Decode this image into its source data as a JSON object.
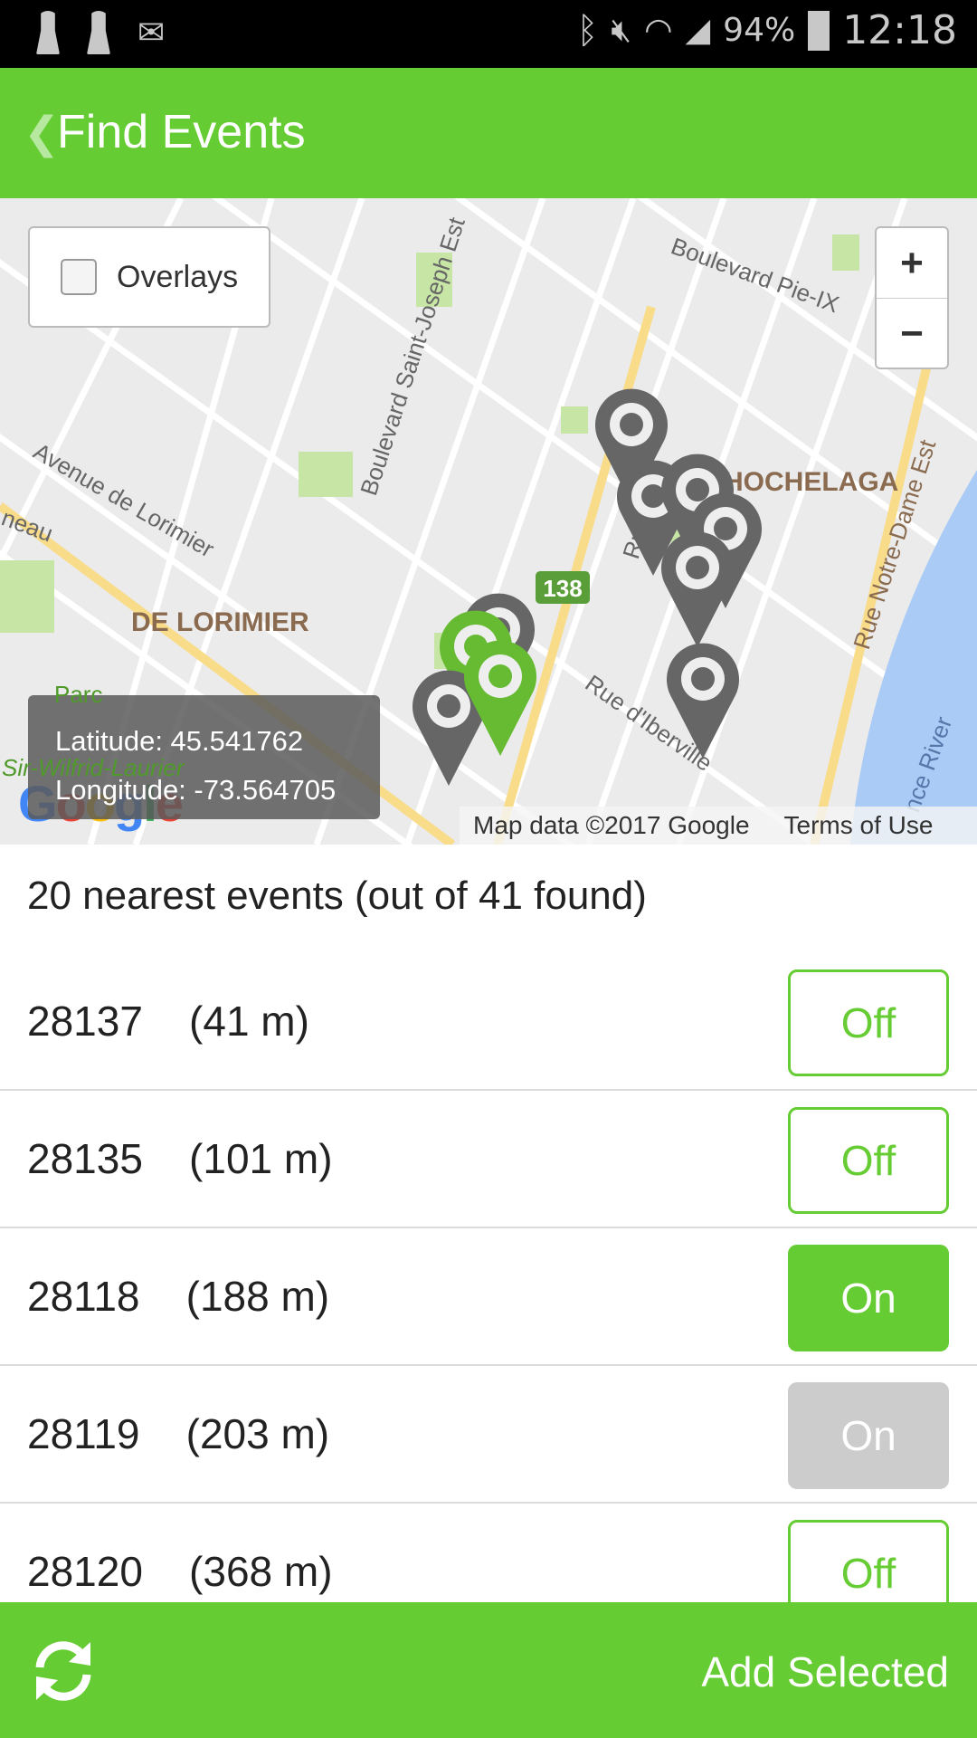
{
  "status_bar": {
    "battery": "94%",
    "time": "12:18"
  },
  "header": {
    "title": "Find Events",
    "back_icon": "chevron-left-icon"
  },
  "map": {
    "overlays_label": "Overlays",
    "overlays_checked": false,
    "zoom_in": "+",
    "zoom_out": "−",
    "latitude": "Latitude: 45.541762",
    "longitude": "Longitude: -73.564705",
    "google_logo": "Google",
    "attribution": "Map data ©2017 Google",
    "terms": "Terms of Use",
    "labels": {
      "blvd_pie_ix": "Boulevard Pie-IX",
      "blvd_st_joseph": "Boulevard Saint-Joseph Est",
      "ave_lorimier": "Avenue de Lorimier",
      "de_lorimier": "DE LORIMIER",
      "hochelaga": "HOCHELAGA",
      "rue_notre_dame": "Rue Notre-Dame Est",
      "rue_iberville": "Rue d'Iberville",
      "route_138": "138",
      "parc": "Parc",
      "sir_wilfrid": "Sir-Wilfrid-Laurier",
      "river": "nce River",
      "neau": "neau",
      "rue_ho": "Rue Ho"
    },
    "colors": {
      "water": "#a9cbf5",
      "park": "#c7e6a6",
      "highway": "#f9dc8a",
      "pin_gray": "#666666",
      "pin_green": "#66bb33"
    }
  },
  "summary": "20 nearest events (out of 41 found)",
  "events": [
    {
      "label": "28137    (41 m)",
      "state": "Off",
      "style": "off"
    },
    {
      "label": "28135    (101 m)",
      "state": "Off",
      "style": "off"
    },
    {
      "label": "28118    (188 m)",
      "state": "On",
      "style": "on"
    },
    {
      "label": "28119    (203 m)",
      "state": "On",
      "style": "dis"
    },
    {
      "label": "28120    (368 m)",
      "state": "Off",
      "style": "off"
    }
  ],
  "footer": {
    "refresh_icon": "refresh-icon",
    "add_selected": "Add Selected"
  },
  "colors": {
    "accent": "#66cc33"
  }
}
